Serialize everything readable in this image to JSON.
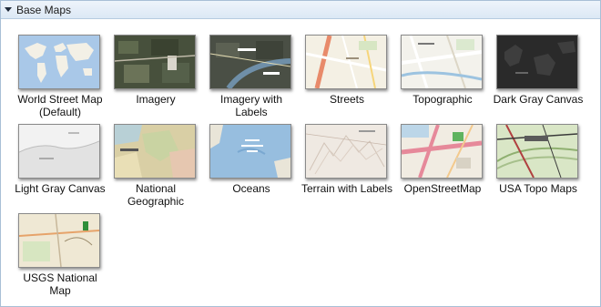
{
  "panel": {
    "title": "Base Maps"
  },
  "basemaps": [
    {
      "label": "World Street Map (Default)",
      "thumbnail": "world-street-map"
    },
    {
      "label": "Imagery",
      "thumbnail": "imagery"
    },
    {
      "label": "Imagery with Labels",
      "thumbnail": "imagery-with-labels"
    },
    {
      "label": "Streets",
      "thumbnail": "streets"
    },
    {
      "label": "Topographic",
      "thumbnail": "topographic"
    },
    {
      "label": "Dark Gray Canvas",
      "thumbnail": "dark-gray-canvas"
    },
    {
      "label": "Light Gray Canvas",
      "thumbnail": "light-gray-canvas"
    },
    {
      "label": "National Geographic",
      "thumbnail": "national-geographic"
    },
    {
      "label": "Oceans",
      "thumbnail": "oceans"
    },
    {
      "label": "Terrain with Labels",
      "thumbnail": "terrain-with-labels"
    },
    {
      "label": "OpenStreetMap",
      "thumbnail": "openstreetmap"
    },
    {
      "label": "USA Topo Maps",
      "thumbnail": "usa-topo-maps"
    },
    {
      "label": "USGS National Map",
      "thumbnail": "usgs-national-map"
    }
  ]
}
